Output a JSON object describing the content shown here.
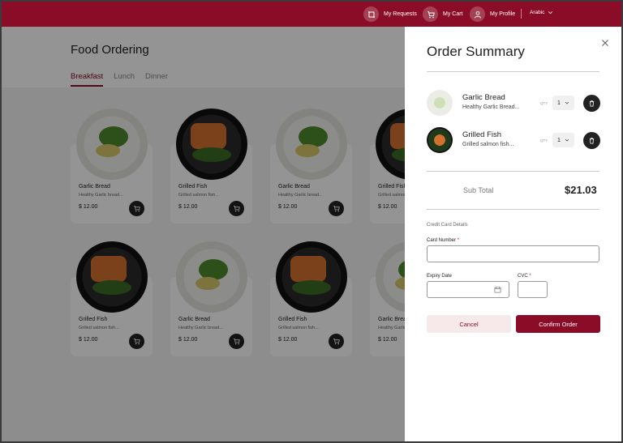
{
  "topbar": {
    "requests_label": "My Requests",
    "cart_label": "My Cart",
    "profile_label": "My Profile",
    "language_label": "Arabic"
  },
  "main": {
    "title": "Food Ordering",
    "tabs": [
      {
        "label": "Breakfast",
        "active": true
      },
      {
        "label": "Lunch",
        "active": false
      },
      {
        "label": "Dinner",
        "active": false
      }
    ],
    "cards": [
      {
        "name": "Garlic Bread",
        "desc": "Healthy Garlic bread...",
        "price": "$ 12.00",
        "image": "bread"
      },
      {
        "name": "Grilled Fish",
        "desc": "Grilled salmon fish...",
        "price": "$ 12.00",
        "image": "fish"
      },
      {
        "name": "Garlic Bread",
        "desc": "Healthy Garlic bread...",
        "price": "$ 12.00",
        "image": "bread"
      },
      {
        "name": "Grilled Fish",
        "desc": "Grilled salmon fish...",
        "price": "$ 12.00",
        "image": "fish"
      },
      {
        "name": "Grilled Fish",
        "desc": "Grilled salmon fish...",
        "price": "$ 12.00",
        "image": "fish"
      },
      {
        "name": "Garlic Bread",
        "desc": "Healthy Garlic bread...",
        "price": "$ 12.00",
        "image": "bread"
      },
      {
        "name": "Grilled Fish",
        "desc": "Grilled salmon fish...",
        "price": "$ 12.00",
        "image": "fish"
      },
      {
        "name": "Garlic Bread",
        "desc": "Healthy Garlic bread...",
        "price": "$ 12.00",
        "image": "bread"
      }
    ]
  },
  "panel": {
    "title": "Order Summary",
    "qty_label": "QTY",
    "items": [
      {
        "name": "Garlic Bread",
        "desc": "Healthy Garlic Bread...",
        "qty": "1",
        "image": "bread"
      },
      {
        "name": "Grilled Fish",
        "desc": "Grilled salmon fish...",
        "qty": "1",
        "image": "fish"
      }
    ],
    "subtotal_label": "Sub Total",
    "subtotal_value": "$21.03",
    "card_section_label": "Credit Card Details",
    "card_number_label": "Card Number",
    "expiry_label": "Expiry Date",
    "cvc_label": "CVC",
    "required_mark": "*",
    "card_number_value": "",
    "expiry_value": "",
    "cvc_value": "",
    "cancel_label": "Cancel",
    "confirm_label": "Confirm Order"
  },
  "colors": {
    "brand": "#8b0c26",
    "cancel_bg": "#f6e9ea",
    "dark_button": "#222222"
  }
}
